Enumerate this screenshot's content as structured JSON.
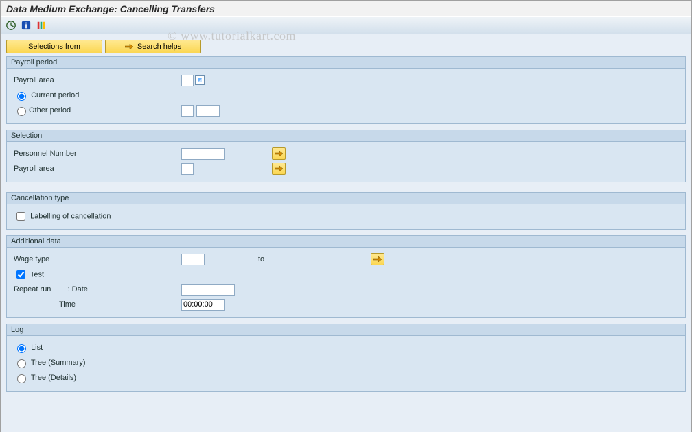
{
  "title": "Data Medium Exchange: Cancelling Transfers",
  "watermark": "© www.tutorialkart.com",
  "toolbar": {
    "execute_icon": "execute",
    "info_icon": "info",
    "variant_icon": "variant"
  },
  "buttons": {
    "selections_from": "Selections from",
    "search_helps": "Search helps"
  },
  "groups": {
    "payroll_period": {
      "title": "Payroll period",
      "payroll_area_label": "Payroll area",
      "current_period": "Current period",
      "other_period": "Other period"
    },
    "selection": {
      "title": "Selection",
      "personnel_number": "Personnel Number",
      "payroll_area": "Payroll area"
    },
    "cancellation_type": {
      "title": "Cancellation type",
      "labelling": "Labelling of cancellation"
    },
    "additional_data": {
      "title": "Additional data",
      "wage_type": "Wage type",
      "to": "to",
      "test": "Test",
      "repeat_run": "Repeat run",
      "date_sep": ": Date",
      "time": "Time",
      "time_value": "00:00:00"
    },
    "log": {
      "title": "Log",
      "list": "List",
      "tree_summary": "Tree (Summary)",
      "tree_details": "Tree (Details)"
    }
  },
  "values": {
    "payroll_area_top": "",
    "period_choice": "current",
    "other_period_a": "",
    "other_period_b": "",
    "personnel_number": "",
    "payroll_area_sel": "",
    "labelling_checked": false,
    "wage_type_from": "",
    "wage_type_to": "",
    "test_checked": true,
    "repeat_date": "",
    "log_choice": "list"
  }
}
